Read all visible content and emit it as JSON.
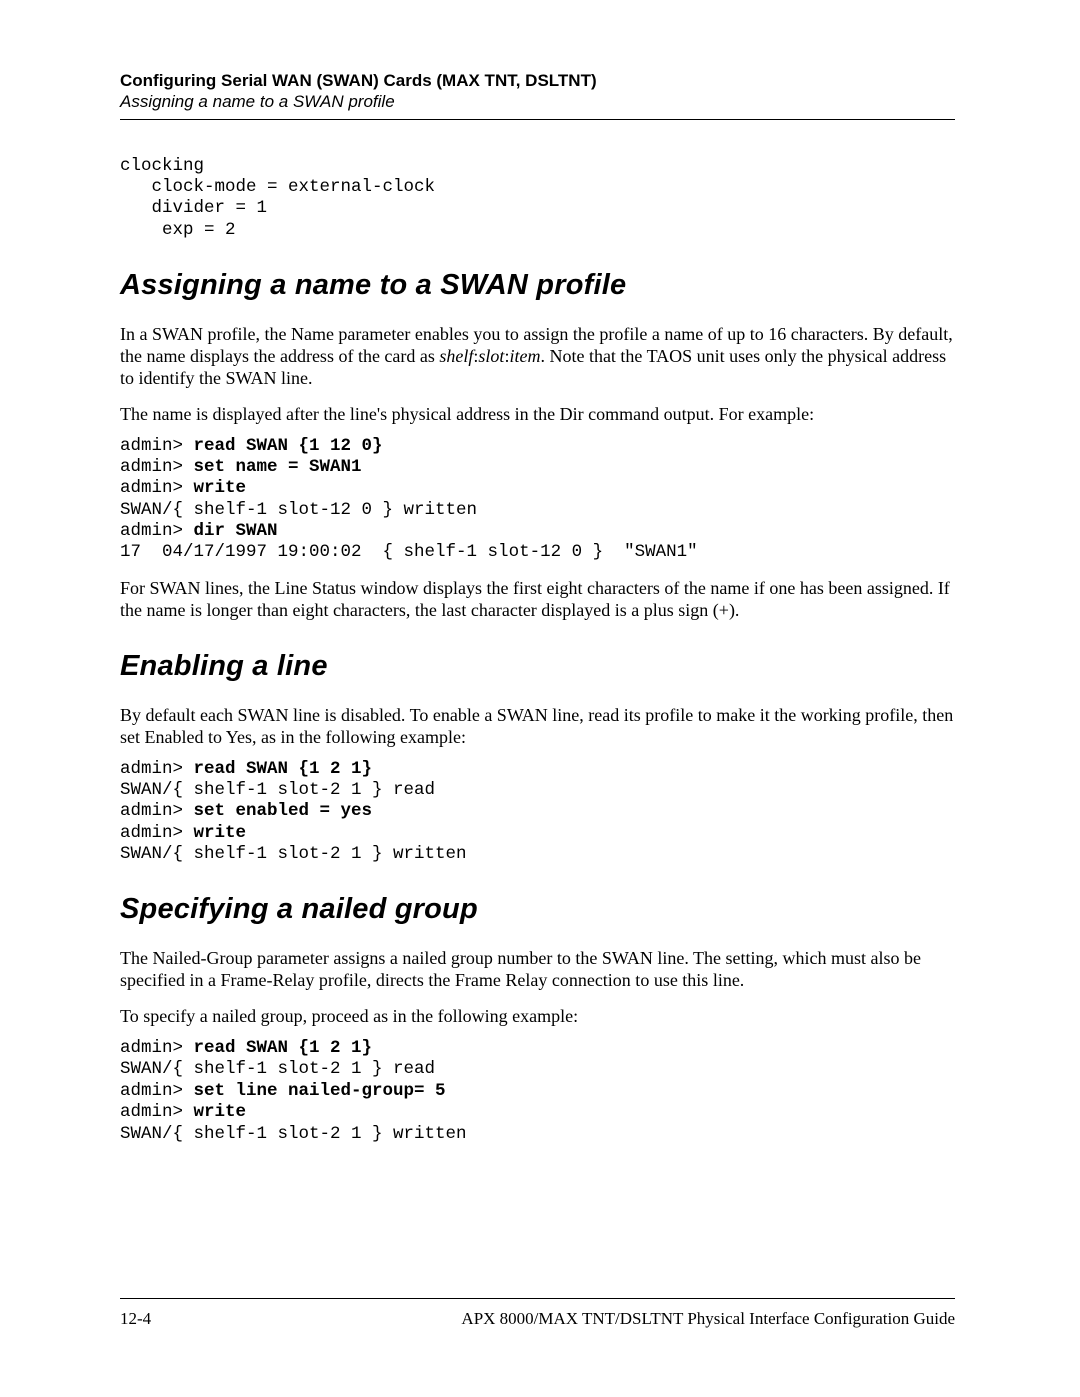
{
  "header": {
    "line1": "Configuring Serial WAN (SWAN) Cards (MAX TNT, DSLTNT)",
    "line2": "Assigning a name to a SWAN profile"
  },
  "code_top": [
    {
      "t": "clocking",
      "b": false,
      "indent": 0
    },
    {
      "t": "clock-mode = external-clock",
      "b": false,
      "indent": 1
    },
    {
      "t": "divider = 1",
      "b": false,
      "indent": 1
    },
    {
      "t": " exp = 2",
      "b": false,
      "indent": 1
    }
  ],
  "sec1": {
    "title": "Assigning a name to a SWAN profile",
    "p1_a": "In a SWAN profile, the Name parameter enables you to assign the profile a name of up to 16 characters. By default, the name displays the address of the card as ",
    "p1_i": "shelf",
    "p1_b": ":",
    "p1_i2": "slot",
    "p1_c": ":",
    "p1_i3": "item",
    "p1_d": ". Note that the TAOS unit uses only the physical address to identify the SWAN line.",
    "p2": "The name is displayed after the line's physical address in the Dir command output. For example:",
    "code": [
      {
        "pre": "admin> ",
        "cmd": "read SWAN {1 12 0}"
      },
      {
        "pre": "admin> ",
        "cmd": "set name = SWAN1"
      },
      {
        "pre": "admin> ",
        "cmd": "write"
      },
      {
        "plain": "SWAN/{ shelf-1 slot-12 0 } written"
      },
      {
        "pre": "admin> ",
        "cmd": "dir SWAN"
      },
      {
        "plain": "17  04/17/1997 19:00:02  { shelf-1 slot-12 0 }  \"SWAN1\""
      }
    ],
    "p3": "For SWAN lines, the Line Status window displays the first eight characters of the name if one has been assigned. If the name is longer than eight characters, the last character displayed is a plus sign (+)."
  },
  "sec2": {
    "title": "Enabling a line",
    "p1": "By default each SWAN line is disabled. To enable a SWAN line, read its profile to make it the working profile, then set Enabled to Yes, as in the following example:",
    "code": [
      {
        "pre": "admin> ",
        "cmd": "read SWAN {1 2 1}"
      },
      {
        "plain": "SWAN/{ shelf-1 slot-2 1 } read"
      },
      {
        "pre": "admin> ",
        "cmd": "set enabled = yes"
      },
      {
        "pre": "admin> ",
        "cmd": "write"
      },
      {
        "plain": "SWAN/{ shelf-1 slot-2 1 } written"
      }
    ]
  },
  "sec3": {
    "title": "Specifying a nailed group",
    "p1": "The Nailed-Group parameter assigns a nailed group number to the SWAN line. The setting, which must also be specified in a Frame-Relay profile, directs the Frame Relay connection to use this line.",
    "p2": "To specify a nailed group, proceed as in the following example:",
    "code": [
      {
        "pre": "admin> ",
        "cmd": "read SWAN {1 2 1}"
      },
      {
        "plain": "SWAN/{ shelf-1 slot-2 1 } read"
      },
      {
        "pre": "admin> ",
        "cmd": "set line nailed-group= 5"
      },
      {
        "pre": "admin> ",
        "cmd": "write"
      },
      {
        "plain": "SWAN/{ shelf-1 slot-2 1 } written"
      }
    ]
  },
  "footer": {
    "left": "12-4",
    "right": "APX 8000/MAX TNT/DSLTNT Physical Interface Configuration Guide"
  }
}
